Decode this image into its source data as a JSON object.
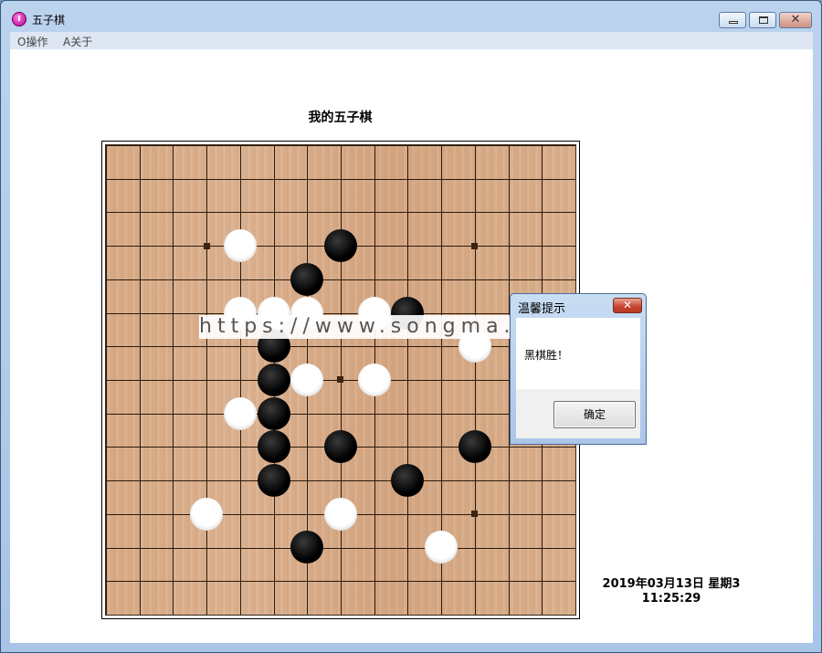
{
  "window": {
    "title": "五子棋",
    "minimize_icon": "minimize-icon",
    "maximize_icon": "maximize-icon",
    "close_icon": "close-icon",
    "close_glyph": "✕"
  },
  "menu": {
    "items": [
      {
        "label": "O操作"
      },
      {
        "label": "A关于"
      }
    ]
  },
  "game": {
    "title": "我的五子棋",
    "board_size": 15,
    "star_points": [
      [
        3,
        3
      ],
      [
        3,
        11
      ],
      [
        7,
        7
      ],
      [
        11,
        11
      ]
    ],
    "stones": [
      {
        "color": "white",
        "row": 3,
        "col": 4
      },
      {
        "color": "black",
        "row": 3,
        "col": 7
      },
      {
        "color": "black",
        "row": 4,
        "col": 6
      },
      {
        "color": "white",
        "row": 5,
        "col": 4
      },
      {
        "color": "white",
        "row": 5,
        "col": 5
      },
      {
        "color": "white",
        "row": 5,
        "col": 6
      },
      {
        "color": "white",
        "row": 5,
        "col": 8
      },
      {
        "color": "black",
        "row": 5,
        "col": 9
      },
      {
        "color": "black",
        "row": 6,
        "col": 5
      },
      {
        "color": "white",
        "row": 6,
        "col": 11
      },
      {
        "color": "black",
        "row": 7,
        "col": 5
      },
      {
        "color": "white",
        "row": 7,
        "col": 6
      },
      {
        "color": "white",
        "row": 7,
        "col": 8
      },
      {
        "color": "white",
        "row": 8,
        "col": 4
      },
      {
        "color": "black",
        "row": 8,
        "col": 5
      },
      {
        "color": "black",
        "row": 9,
        "col": 5
      },
      {
        "color": "black",
        "row": 9,
        "col": 7
      },
      {
        "color": "black",
        "row": 9,
        "col": 11
      },
      {
        "color": "black",
        "row": 10,
        "col": 5
      },
      {
        "color": "black",
        "row": 10,
        "col": 9
      },
      {
        "color": "white",
        "row": 11,
        "col": 3
      },
      {
        "color": "white",
        "row": 11,
        "col": 7
      },
      {
        "color": "black",
        "row": 12,
        "col": 6
      },
      {
        "color": "white",
        "row": 12,
        "col": 10
      }
    ]
  },
  "watermark": "https://www.songma.com",
  "status": {
    "date": "2019年03月13日 星期3",
    "time": "11:25:29"
  },
  "dialog": {
    "title": "温馨提示",
    "message": "黑棋胜！",
    "ok_label": "确定",
    "close_glyph": "✕"
  }
}
